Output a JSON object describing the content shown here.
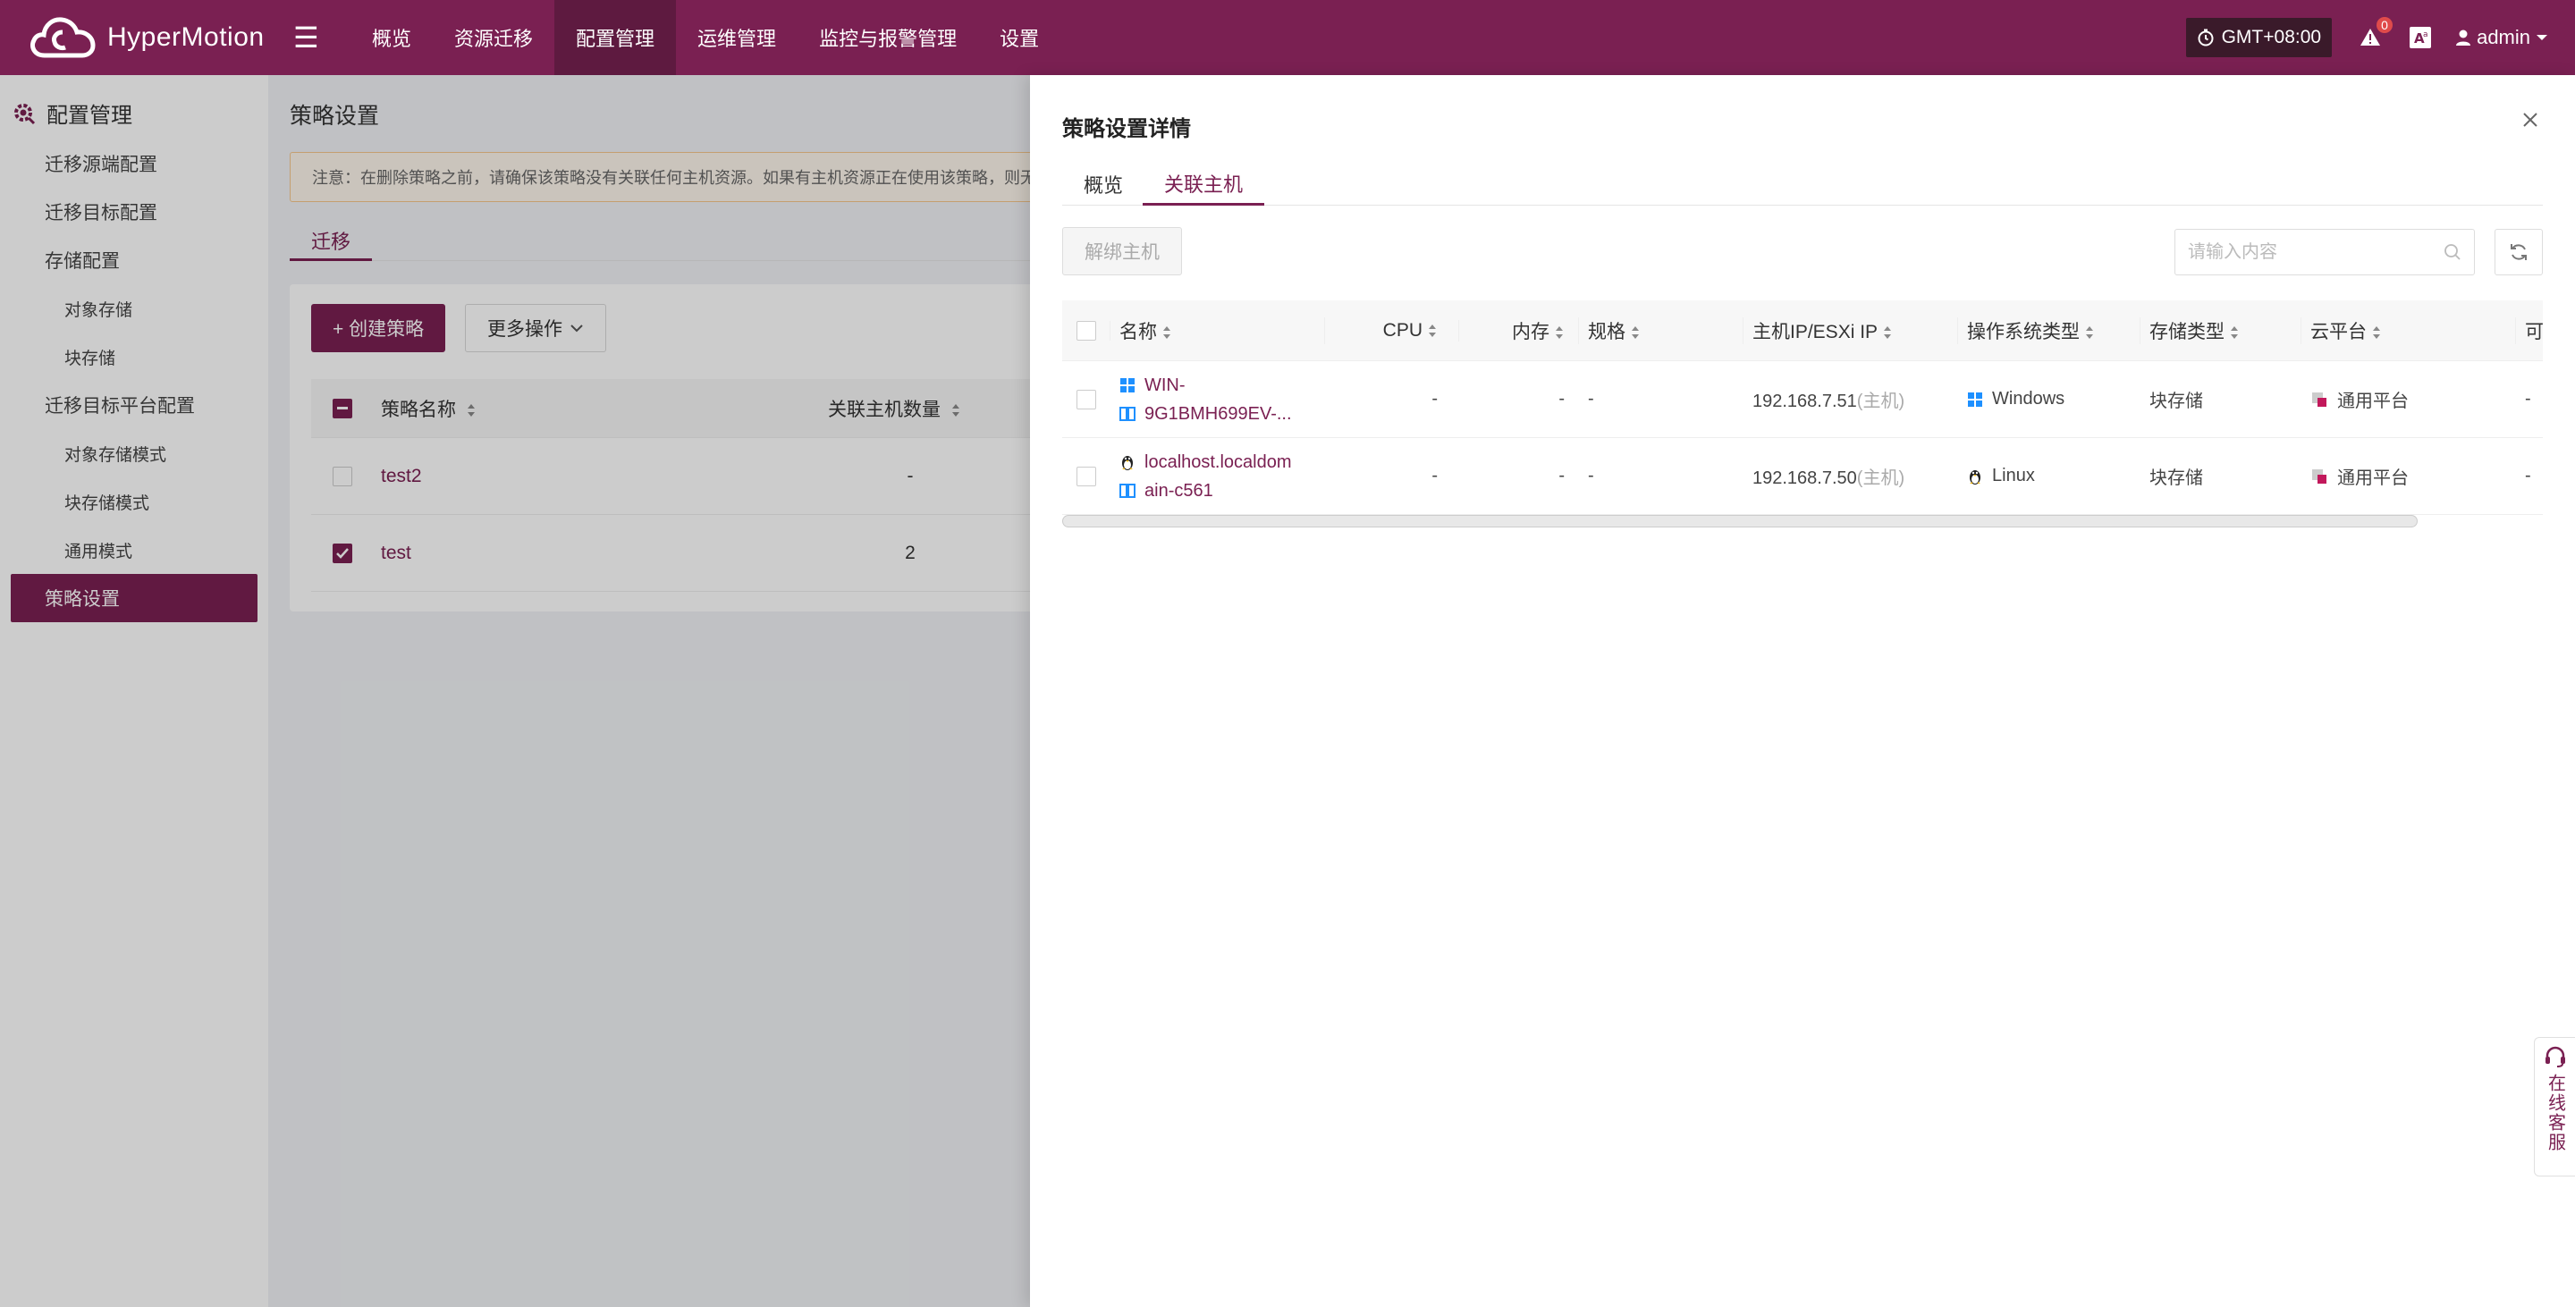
{
  "app": {
    "name": "HyperMotion",
    "nav": [
      "概览",
      "资源迁移",
      "配置管理",
      "运维管理",
      "监控与报警管理",
      "设置"
    ],
    "active_nav_index": 2,
    "timezone": "GMT+08:00",
    "alert_count": "0",
    "user": "admin"
  },
  "sidebar": {
    "title": "配置管理",
    "items": [
      {
        "label": "迁移源端配置"
      },
      {
        "label": "迁移目标配置"
      },
      {
        "label": "存储配置"
      },
      {
        "label": "对象存储"
      },
      {
        "label": "块存储"
      },
      {
        "label": "迁移目标平台配置"
      },
      {
        "label": "对象存储模式"
      },
      {
        "label": "块存储模式"
      },
      {
        "label": "通用模式"
      },
      {
        "label": "策略设置"
      }
    ]
  },
  "page": {
    "title": "策略设置",
    "notice": "注意：在删除策略之前，请确保该策略没有关联任何主机资源。如果有主机资源正在使用该策略，则无",
    "tab": "迁移",
    "create_button": "+ 创建策略",
    "more_button": "更多操作",
    "table": {
      "headers": [
        "策略名称",
        "关联主机数量"
      ],
      "rows": [
        {
          "name": "test2",
          "count": "-",
          "checked": false
        },
        {
          "name": "test",
          "count": "2",
          "checked": true
        }
      ]
    }
  },
  "drawer": {
    "title": "策略设置详情",
    "tabs": [
      "概览",
      "关联主机"
    ],
    "active_tab_index": 1,
    "unbind_button": "解绑主机",
    "search_placeholder": "请输入内容",
    "table": {
      "headers": [
        "名称",
        "CPU",
        "内存",
        "规格",
        "主机IP/ESXi IP",
        "操作系统类型",
        "存储类型",
        "云平台",
        "可"
      ],
      "rows": [
        {
          "name_line1": "WIN-",
          "name_line2": "9G1BMH699EV-...",
          "cpu": "-",
          "mem": "-",
          "spec": "-",
          "ip": "192.168.7.51",
          "ip_suffix": "(主机)",
          "os": "Windows",
          "os_icon": "windows-icon",
          "storage": "块存储",
          "cloud": "通用平台",
          "extra": "-"
        },
        {
          "name_line1": "localhost.localdom",
          "name_line2": "ain-c561",
          "cpu": "-",
          "mem": "-",
          "spec": "-",
          "ip": "192.168.7.50",
          "ip_suffix": "(主机)",
          "os": "Linux",
          "os_icon": "linux-icon",
          "storage": "块存储",
          "cloud": "通用平台",
          "extra": "-"
        }
      ]
    }
  },
  "online_service": "在线客服",
  "colors": {
    "brand": "#7a2052",
    "brand_dark": "#5e1a40"
  }
}
